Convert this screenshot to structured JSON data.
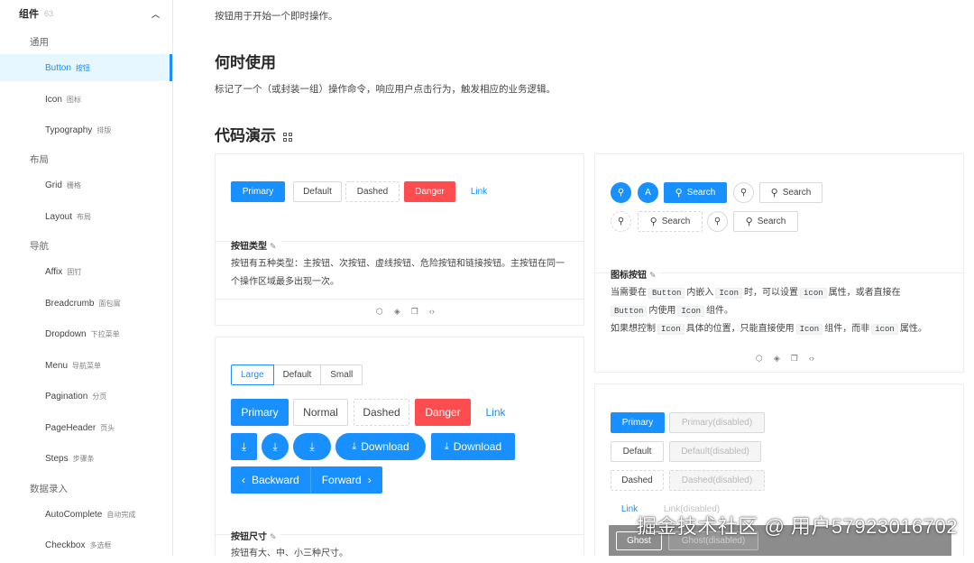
{
  "sidebar": {
    "group": {
      "label": "组件",
      "count": "63"
    },
    "sections": {
      "general": "通用",
      "layout": "布局",
      "nav": "导航",
      "input": "数据录入"
    },
    "items": [
      {
        "label": "Button",
        "sub": "按钮",
        "active": true
      },
      {
        "label": "Icon",
        "sub": "图标"
      },
      {
        "label": "Typography",
        "sub": "排版"
      },
      {
        "label": "Grid",
        "sub": "栅格"
      },
      {
        "label": "Layout",
        "sub": "布局"
      },
      {
        "label": "Affix",
        "sub": "固钉"
      },
      {
        "label": "Breadcrumb",
        "sub": "面包屑"
      },
      {
        "label": "Dropdown",
        "sub": "下拉菜单"
      },
      {
        "label": "Menu",
        "sub": "导航菜单"
      },
      {
        "label": "Pagination",
        "sub": "分页"
      },
      {
        "label": "PageHeader",
        "sub": "页头"
      },
      {
        "label": "Steps",
        "sub": "步骤条"
      },
      {
        "label": "AutoComplete",
        "sub": "自动完成"
      },
      {
        "label": "Checkbox",
        "sub": "多选框"
      }
    ]
  },
  "main": {
    "intro": "按钮用于开始一个即时操作。",
    "when_title": "何时使用",
    "when_desc": "标记了一个（或封装一组）操作命令，响应用户点击行为，触发相应的业务逻辑。",
    "demo_title": "代码演示"
  },
  "demo_types": {
    "buttons": {
      "primary": "Primary",
      "default": "Default",
      "dashed": "Dashed",
      "danger": "Danger",
      "link": "Link"
    },
    "title": "按钮类型",
    "desc": "按钮有五种类型：主按钮、次按钮、虚线按钮、危险按钮和链接按钮。主按钮在同一个操作区域最多出现一次。"
  },
  "demo_size": {
    "sizes": [
      "Large",
      "Default",
      "Small"
    ],
    "buttons": {
      "primary": "Primary",
      "normal": "Normal",
      "dashed": "Dashed",
      "danger": "Danger",
      "link": "Link"
    },
    "download": "Download",
    "backward": "Backward",
    "forward": "Forward",
    "title": "按钮尺寸",
    "desc": "按钮有大、中、小三种尺寸。"
  },
  "demo_icon": {
    "circle_letter": "A",
    "search": "Search",
    "title": "图标按钮",
    "line1_a": "当需要在",
    "line1_b": "内嵌入",
    "line1_c": "时，可以设置",
    "line1_d": "属性，或者直接在",
    "line2_a": "内使用",
    "line2_b": "组件。",
    "line3_a": "如果想控制",
    "line3_b": "具体的位置，只能直接使用",
    "line3_c": "组件，而非",
    "line3_d": "属性。",
    "code_button": "Button",
    "code_icon_cmp": "Icon",
    "code_icon_prop": "icon"
  },
  "demo_disabled": {
    "primary": "Primary",
    "primary_d": "Primary(disabled)",
    "default": "Default",
    "default_d": "Default(disabled)",
    "dashed": "Dashed",
    "dashed_d": "Dashed(disabled)",
    "link": "Link",
    "link_d": "Link(disabled)",
    "ghost": "Ghost",
    "ghost_d": "Ghost(disabled)"
  },
  "watermark": "掘金技术社区 @ 用户57923016702",
  "colors": {
    "primary": "#1890ff",
    "danger": "#ff4d4f",
    "active_bg": "#e6f7ff"
  }
}
